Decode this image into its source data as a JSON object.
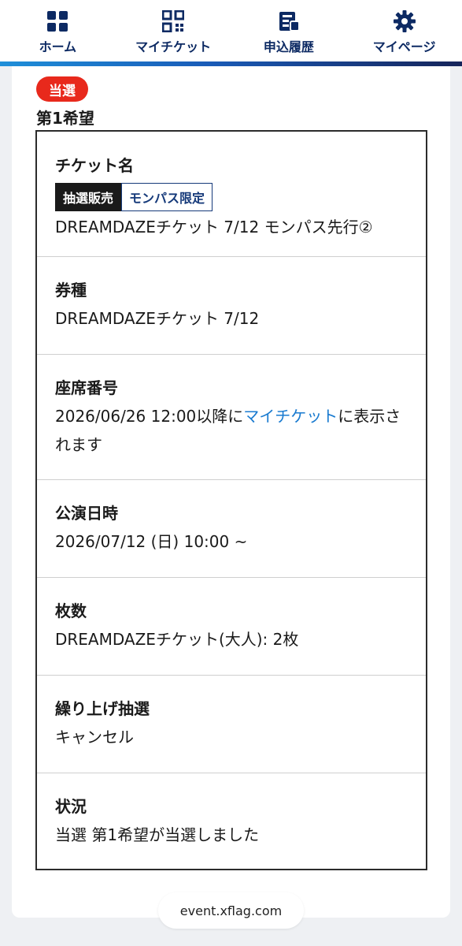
{
  "nav": {
    "items": [
      {
        "label": "ホーム",
        "icon": "home-grid-icon"
      },
      {
        "label": "マイチケット",
        "icon": "qr-code-icon"
      },
      {
        "label": "申込履歴",
        "icon": "history-icon"
      },
      {
        "label": "マイページ",
        "icon": "gear-icon"
      }
    ],
    "accent_colors": [
      "#1f8fd9",
      "#16245a"
    ],
    "label_color": "#0d2a63"
  },
  "result": {
    "status_badge": "当選",
    "status_color": "#e8291c",
    "choice_title": "第1希望"
  },
  "details": {
    "ticket_name": {
      "label": "チケット名",
      "tags": [
        "抽選販売",
        "モンパス限定"
      ],
      "value": "DREAMDAZEチケット 7/12 モンパス先行②"
    },
    "ticket_type": {
      "label": "券種",
      "value": "DREAMDAZEチケット 7/12"
    },
    "seat": {
      "label": "座席番号",
      "value_before": "2026/06/26 12:00以降に",
      "value_link": "マイチケット",
      "value_after": "に表示されます"
    },
    "datetime": {
      "label": "公演日時",
      "value": "2026/07/12 (日) 10:00 ~"
    },
    "quantity": {
      "label": "枚数",
      "value": "DREAMDAZEチケット(大人): 2枚"
    },
    "waitlist": {
      "label": "繰り上げ抽選",
      "value": "キャンセル"
    },
    "status": {
      "label": "状況",
      "value": "当選 第1希望が当選しました"
    }
  },
  "browser": {
    "url": "event.xflag.com"
  }
}
